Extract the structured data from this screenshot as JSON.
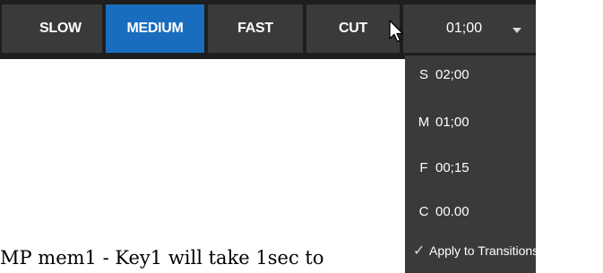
{
  "toolbar": {
    "buttons": [
      {
        "id": "slow",
        "label": "SLOW",
        "selected": false
      },
      {
        "id": "medium",
        "label": "MEDIUM",
        "selected": true
      },
      {
        "id": "fast",
        "label": "FAST",
        "selected": false
      },
      {
        "id": "cut",
        "label": "CUT",
        "selected": false
      }
    ],
    "duration": {
      "value": "01;00",
      "icon": "chevron-down-icon"
    }
  },
  "dropdown": {
    "items": [
      {
        "prefix": "S",
        "time": "02;00"
      },
      {
        "prefix": "M",
        "time": "01;00"
      },
      {
        "prefix": "F",
        "time": "00;15"
      },
      {
        "prefix": "C",
        "time": "00.00"
      }
    ],
    "apply": {
      "label": "Apply to Transitions",
      "checked": true,
      "icon": "checkmark-icon"
    }
  },
  "body_text": "MP mem1 - Key1 will take 1sec to",
  "colors": {
    "toolbar_bg": "#1e1e1e",
    "button_bg": "#3a3a3a",
    "selected_bg": "#1a6dbe",
    "text": "#ffffff"
  }
}
